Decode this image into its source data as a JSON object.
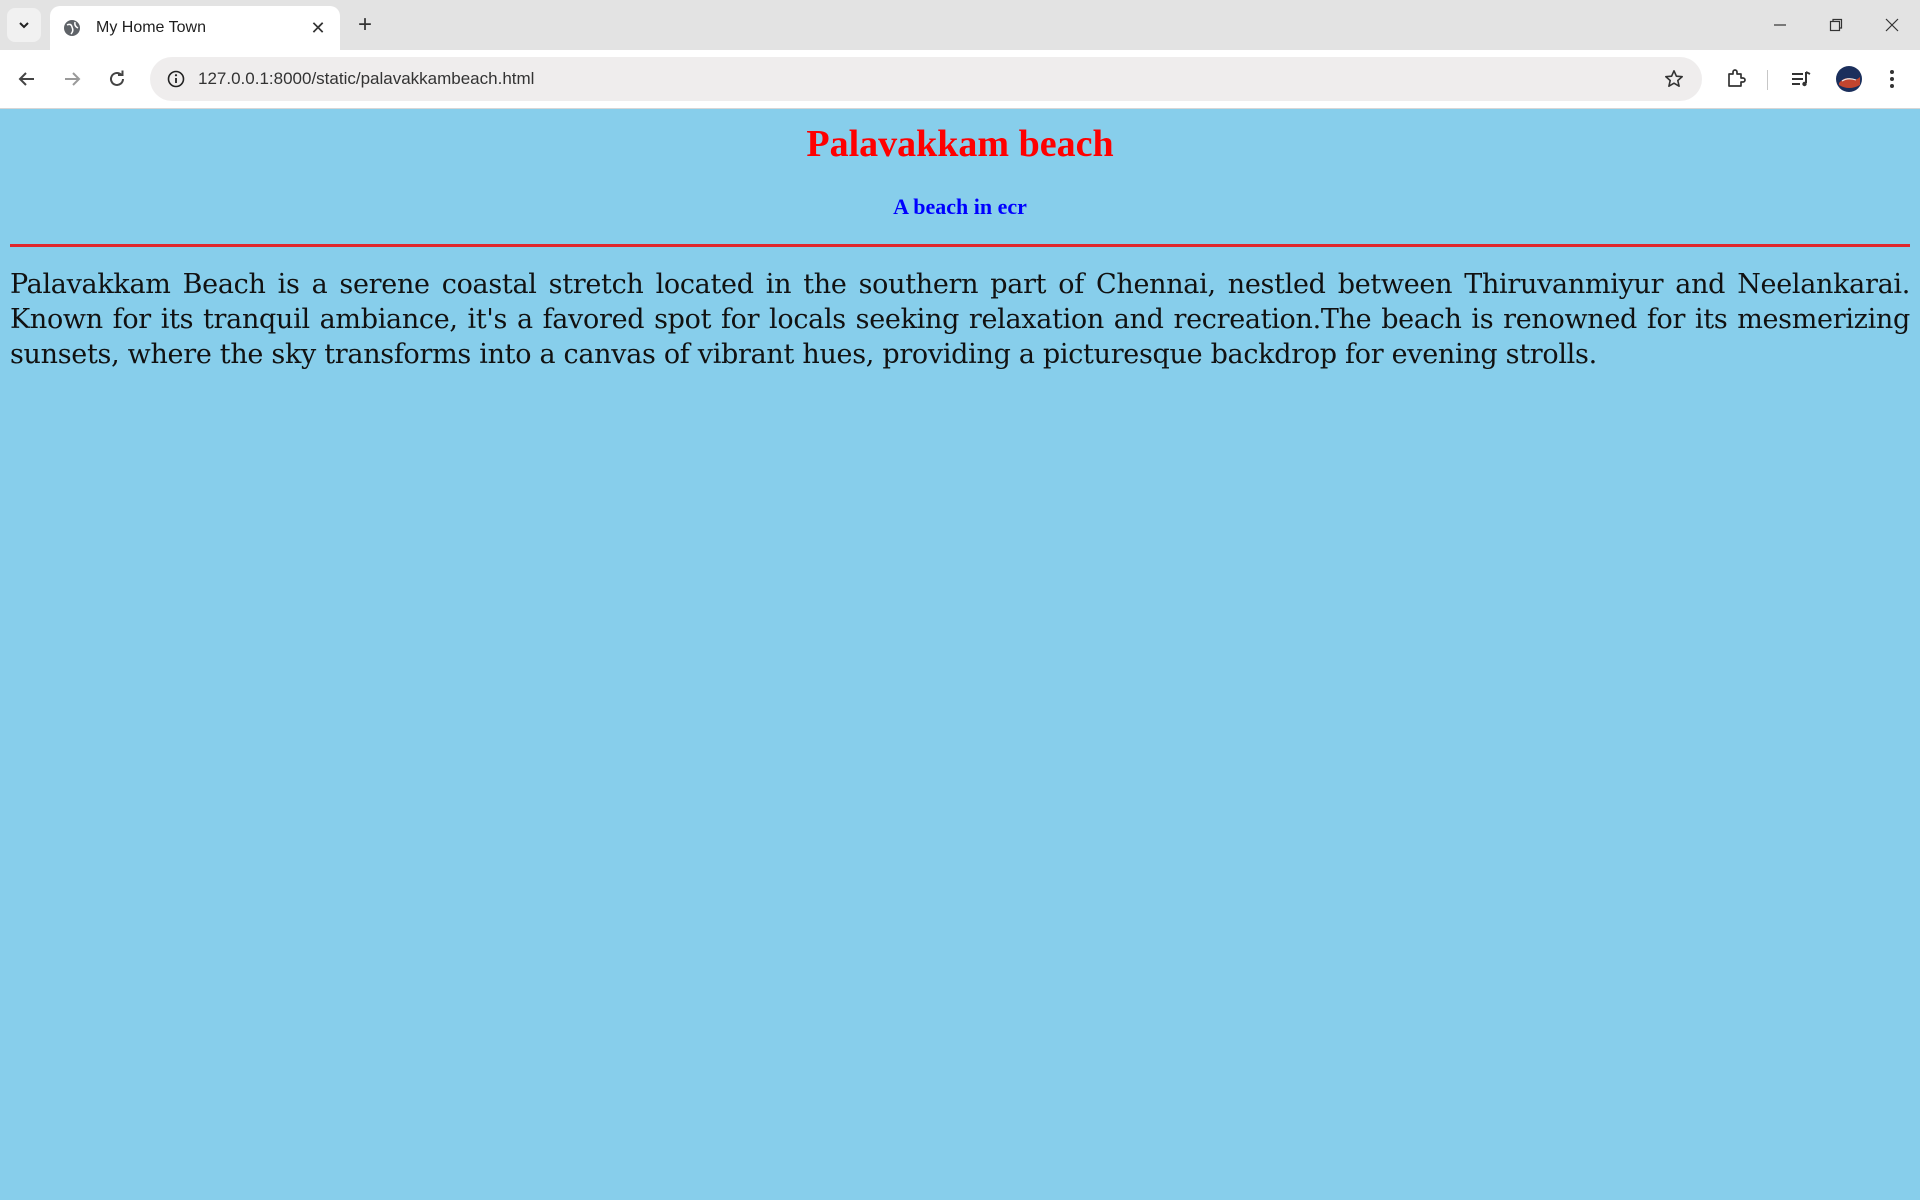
{
  "browser": {
    "tab_title": "My Home Town",
    "new_tab_symbol": "+",
    "close_tab_symbol": "✕",
    "url": "127.0.0.1:8000/static/palavakkambeach.html"
  },
  "page": {
    "title": "Palavakkam beach",
    "subtitle": "A beach in ecr",
    "paragraph": "Palavakkam Beach is a serene coastal stretch located in the southern part of Chennai, nestled between Thiruvanmiyur and Neelankarai. Known for its tranquil ambiance, it's a favored spot for locals seeking relaxation and recreation.The beach is renowned for its mesmerizing sunsets, where the sky transforms into a canvas of vibrant hues, providing a picturesque backdrop for evening strolls."
  },
  "colors": {
    "background": "#87ceeb",
    "title": "#ff0000",
    "subtitle": "#0000ff",
    "rule": "#e0272d"
  },
  "icons": [
    "tab-search-icon",
    "globe-icon",
    "close-icon",
    "plus-icon",
    "minimize-icon",
    "restore-icon",
    "window-close-icon",
    "back-arrow-icon",
    "forward-arrow-icon",
    "reload-icon",
    "site-info-icon",
    "bookmark-star-icon",
    "extensions-icon",
    "media-control-icon",
    "profile-avatar",
    "kebab-menu-icon"
  ]
}
